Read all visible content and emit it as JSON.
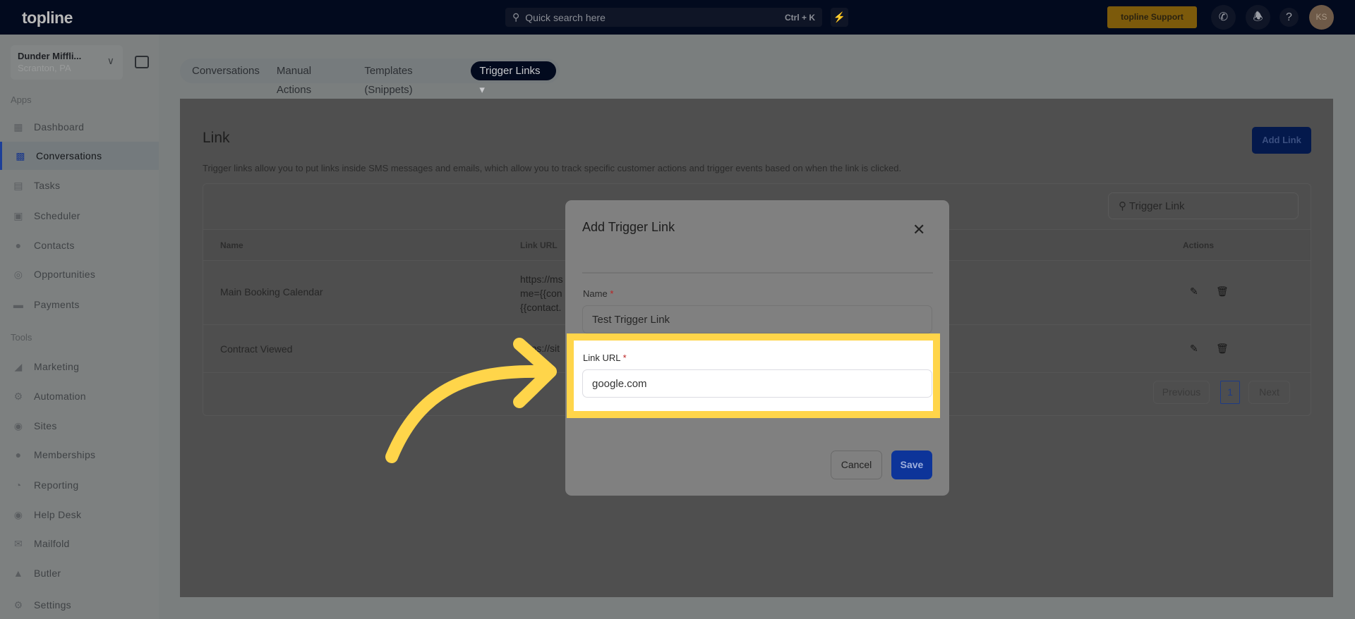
{
  "header": {
    "logo": "topline",
    "search_placeholder": "Quick search here",
    "search_shortcut": "Ctrl + K",
    "support_label": "topline Support",
    "avatar_initials": "KS"
  },
  "account": {
    "name": "Dunder Miffli...",
    "location": "Scranton, PA"
  },
  "sidebar": {
    "apps_label": "Apps",
    "apps": [
      {
        "label": "Dashboard",
        "icon": "dashboard-icon"
      },
      {
        "label": "Conversations",
        "icon": "chat-icon",
        "active": true
      },
      {
        "label": "Tasks",
        "icon": "tasks-icon"
      },
      {
        "label": "Scheduler",
        "icon": "calendar-icon"
      },
      {
        "label": "Contacts",
        "icon": "person-icon"
      },
      {
        "label": "Opportunities",
        "icon": "target-icon"
      },
      {
        "label": "Payments",
        "icon": "card-icon"
      }
    ],
    "tools_label": "Tools",
    "tools": [
      {
        "label": "Marketing",
        "icon": "megaphone-icon"
      },
      {
        "label": "Automation",
        "icon": "gears-icon"
      },
      {
        "label": "Sites",
        "icon": "globe-icon"
      },
      {
        "label": "Memberships",
        "icon": "users-icon"
      },
      {
        "label": "Reporting",
        "icon": "pie-icon"
      },
      {
        "label": "Help Desk",
        "icon": "help-icon"
      },
      {
        "label": "Mailfold",
        "icon": "mail-icon"
      },
      {
        "label": "Butler",
        "icon": "cloche-icon"
      }
    ],
    "settings": "Settings"
  },
  "tabs": [
    "Conversations",
    "Manual Actions",
    "Templates (Snippets)",
    "Trigger Links"
  ],
  "page": {
    "title": "Link",
    "description": "Trigger links allow you to put links inside SMS messages and emails, which allow you to track specific customer actions and trigger events based on when the link is clicked.",
    "add_button": "Add Link",
    "search_value": "Trigger Link"
  },
  "table": {
    "columns": [
      "Name",
      "Link URL",
      "Actions"
    ],
    "rows": [
      {
        "name": "Main Booking Calendar",
        "url_lines": [
          "https://ms",
          "me={{con",
          "{{contact."
        ]
      },
      {
        "name": "Contract Viewed",
        "url_lines": [
          "https://sit"
        ]
      }
    ]
  },
  "pagination": {
    "previous": "Previous",
    "current": "1",
    "next": "Next"
  },
  "modal": {
    "title": "Add Trigger Link",
    "name_label": "Name",
    "name_value": "Test Trigger Link",
    "url_label": "Link URL",
    "url_value": "google.com",
    "required_mark": "*",
    "cancel": "Cancel",
    "save": "Save"
  },
  "colors": {
    "highlight": "#ffd54a",
    "primary": "#0d3499",
    "header_bg": "#020a1e"
  }
}
